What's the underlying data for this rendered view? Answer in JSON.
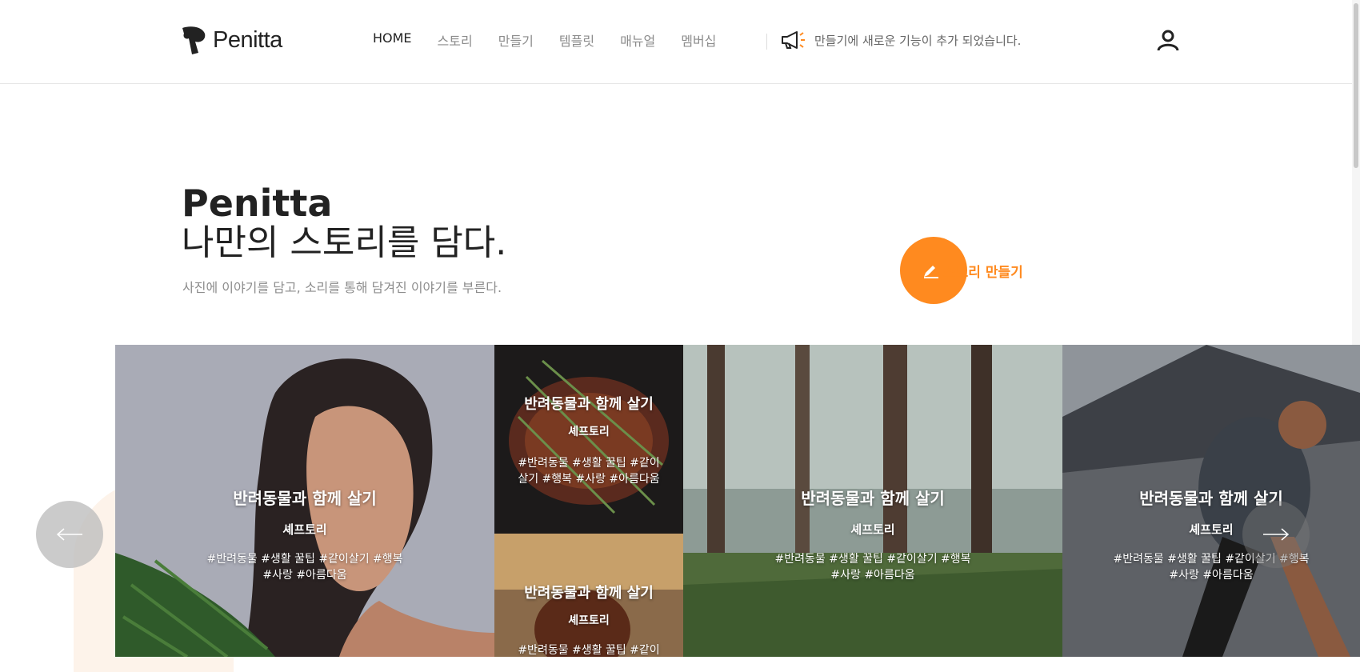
{
  "brand": {
    "name": "Penitta"
  },
  "nav": {
    "items": [
      {
        "label": "HOME"
      },
      {
        "label": "스토리"
      },
      {
        "label": "만들기"
      },
      {
        "label": "템플릿"
      },
      {
        "label": "매뉴얼"
      },
      {
        "label": "멤버십"
      }
    ]
  },
  "notice": {
    "text": "만들기에 새로운 기능이 추가 되었습니다."
  },
  "hero": {
    "title": "Penitta",
    "subtitle": "나만의 스토리를 담다.",
    "description": "사진에 이야기를 담고, 소리를 통해 담겨진 이야기를 부른다.",
    "cta_label": "스토리 만들기"
  },
  "cards": [
    {
      "title": "반려동물과 함께 살기",
      "author": "셰프토리",
      "tags_line1": "#반려동물 #생활 꿀팁 #같이살기 #행복",
      "tags_line2": "#사랑 #아름다움"
    },
    {
      "title": "반려동물과 함께 살기",
      "author": "셰프토리",
      "tags_line1": "#반려동물 #생활 꿀팁 #같이",
      "tags_line2": "살기 #행복 #사랑 #아름다움"
    },
    {
      "title": "반려동물과 함께 살기",
      "author": "셰프토리",
      "tags_line1": "#반려동물 #생활 꿀팁 #같이",
      "tags_line2": ""
    },
    {
      "title": "반려동물과 함께 살기",
      "author": "셰프토리",
      "tags_line1": "#반려동물 #생활 꿀팁 #같이살기 #행복",
      "tags_line2": "#사랑 #아름다움"
    },
    {
      "title": "반려동물과 함께 살기",
      "author": "셰프토리",
      "tags_line1": "#반려동물 #생활 꿀팁 #같이살기 #행복",
      "tags_line2": "#사랑 #아름다움"
    }
  ],
  "colors": {
    "accent": "#ff8a1f",
    "text": "#222222",
    "muted": "#8c8c8c"
  },
  "icons": {
    "logo": "penitta-logo-icon",
    "notice": "megaphone-icon",
    "user": "user-icon",
    "edit": "pencil-icon",
    "prev": "arrow-left-icon",
    "next": "arrow-right-icon"
  }
}
